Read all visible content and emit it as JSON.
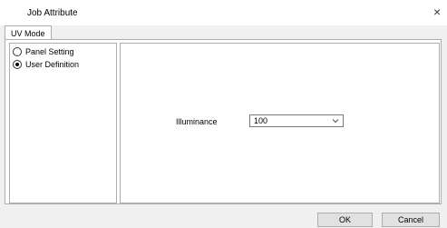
{
  "window": {
    "title": "Job Attribute",
    "close_glyph": "×"
  },
  "tabs": [
    {
      "label": "UV Mode"
    }
  ],
  "options": [
    {
      "label": "Panel Setting",
      "checked": false
    },
    {
      "label": "User Definition",
      "checked": true
    }
  ],
  "illuminance": {
    "label": "Illuminance",
    "value": "100"
  },
  "buttons": {
    "ok": "OK",
    "cancel": "Cancel"
  },
  "icons": {
    "close": "close-icon",
    "dropdown": "chevron-down-icon"
  }
}
